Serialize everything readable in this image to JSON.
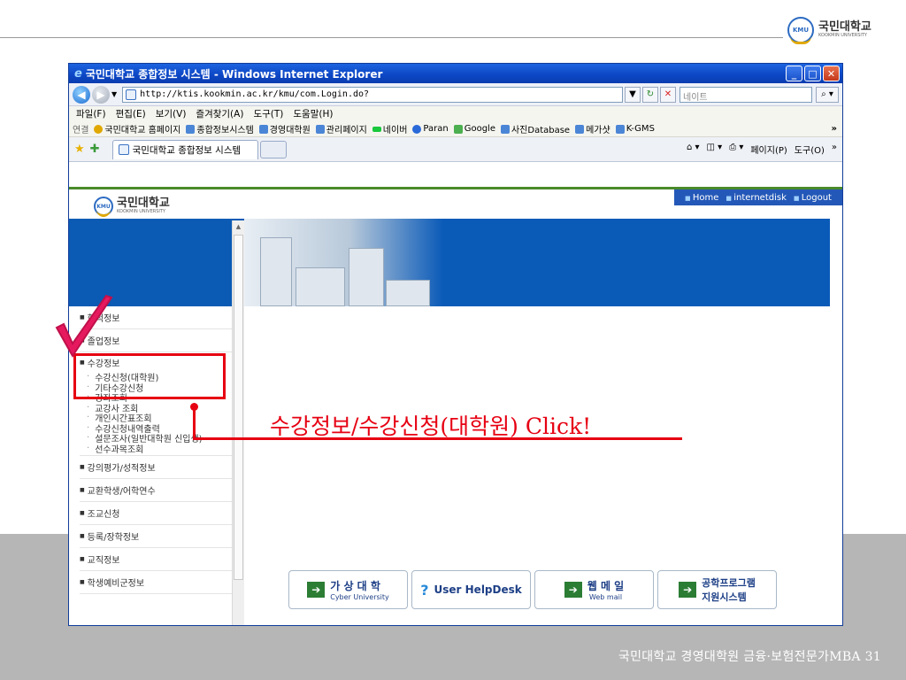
{
  "slide": {
    "logo_en": "KMU",
    "logo_ko": "국민대학교",
    "logo_sub": "KOOKMIN UNIVERSITY",
    "footer": "국민대학교 경영대학원 금융·보험전문가MBA 31",
    "callout": "수강정보/수강신청(대학원) Click!"
  },
  "browser": {
    "title": "국민대학교 종합정보 시스템 - Windows Internet Explorer",
    "url": "http://ktis.kookmin.ac.kr/kmu/com.Login.do?",
    "search_placeholder": "네이트",
    "menu": [
      "파일(F)",
      "편집(E)",
      "보기(V)",
      "즐겨찾기(A)",
      "도구(T)",
      "도움말(H)"
    ],
    "links_label": "연결",
    "links": [
      "국민대학교 홈페이지",
      "종합정보시스템",
      "경영대학원",
      "관리페이지",
      "네이버",
      "Paran",
      "Google",
      "사진Database",
      "메가샷",
      "K-GMS"
    ],
    "more": "»",
    "tab_title": "국민대학교 종합정보 시스템",
    "tools": [
      "페이지(P)",
      "도구(O)"
    ]
  },
  "site": {
    "logo_en": "KMU",
    "logo_ko": "국민대학교",
    "logo_sub": "KOOKMIN UNIVERSITY",
    "toplinks": [
      "Home",
      "internetdisk",
      "Logout"
    ],
    "menu_top": [
      "학적정보",
      "졸업정보",
      "수강정보"
    ],
    "submenu": [
      "수강신청(대학원)",
      "기타수강신청",
      "강좌조회",
      "교강사 조회",
      "개인시간표조회",
      "수강신청내역출력",
      "설문조사(일반대학원 신입생)",
      "선수과목조회"
    ],
    "menu_bottom": [
      "강의평가/성적정보",
      "교환학생/어학연수",
      "조교신청",
      "등록/장학정보",
      "교직정보",
      "학생예비군정보"
    ],
    "buttons": [
      {
        "label": "가 상 대 학",
        "sub": "Cyber University"
      },
      {
        "label": "User HelpDesk",
        "sub": ""
      },
      {
        "label": "웹 메 일",
        "sub": "Web mail"
      },
      {
        "label": "공학프로그램",
        "sub": "지원시스템"
      }
    ]
  }
}
